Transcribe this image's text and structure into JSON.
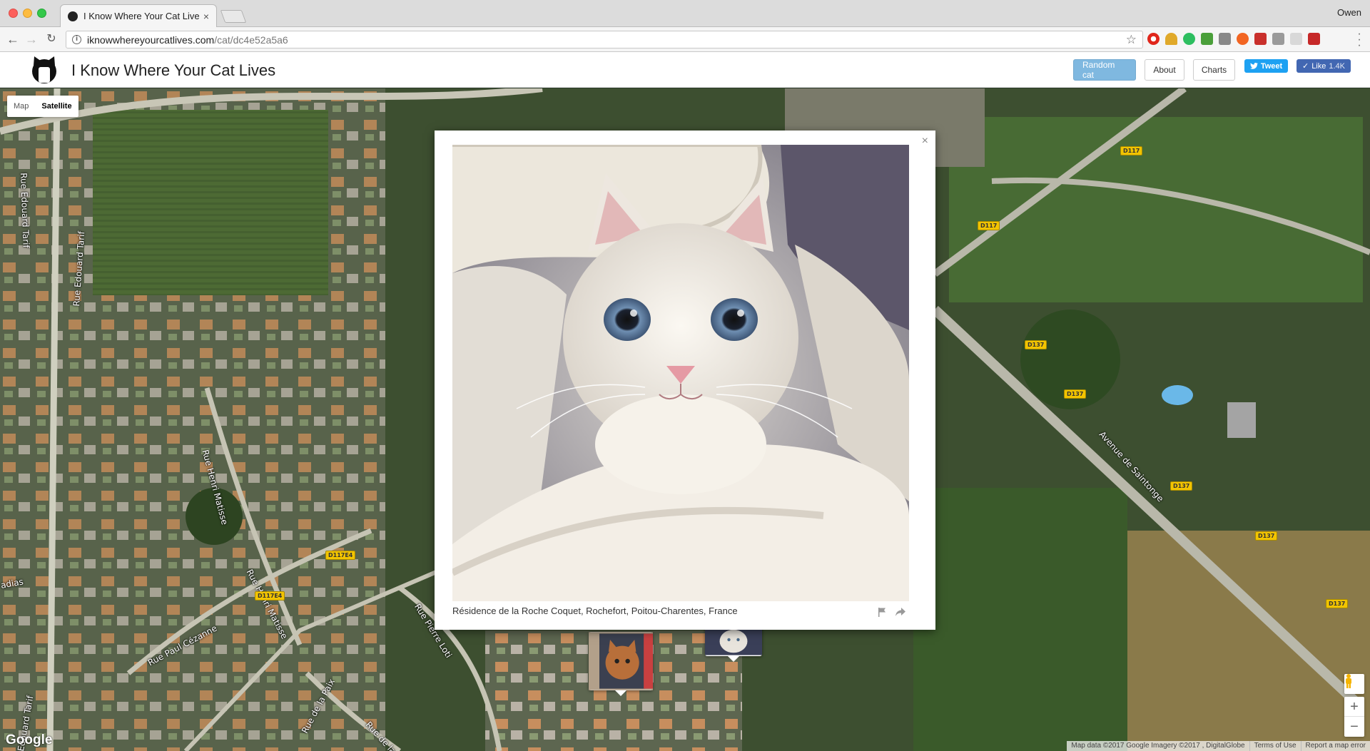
{
  "browser": {
    "tab_title": "I Know Where Your Cat Lives",
    "tab_close": "×",
    "profile_name": "Owen",
    "url_host": "iknowwhereyourcatlives.com",
    "url_path": "/cat/dc4e52a5a6"
  },
  "header": {
    "site_title": "I Know Where Your Cat Lives",
    "random_cat": "Random cat",
    "about": "About",
    "charts": "Charts",
    "tweet": "Tweet",
    "like": "Like",
    "like_count": "1.4K"
  },
  "map": {
    "map_type_options": [
      "Map",
      "Satellite"
    ],
    "selected_type": "Satellite",
    "google_label": "Google",
    "attribution": [
      "Map data ©2017 Google Imagery ©2017 , DigitalGlobe",
      "Terms of Use",
      "Report a map error"
    ],
    "zoom_in": "+",
    "zoom_out": "−",
    "roads": [
      "Rue Edouard Tarif",
      "Rue Edouard Tarif",
      "Rue Henri Matisse",
      "Rue Henri Matisse",
      "Rue Paul Cézanne",
      "Rue de la Paix",
      "Rue de la P",
      "Rue Pierre Loti",
      "Avenue de Saintonge",
      "adias",
      "Edouard Tarif"
    ],
    "shields": [
      "D117",
      "D117",
      "D137",
      "D137",
      "D137",
      "D137",
      "D137",
      "D117E4",
      "D117E4"
    ]
  },
  "modal": {
    "close": "×",
    "caption": "Résidence de la Roche Coquet, Rochefort, Poitou-Charentes, France"
  },
  "colors": {
    "random_button": "#7fb8e0",
    "tweet": "#1da1f2",
    "facebook": "#4267b2"
  }
}
